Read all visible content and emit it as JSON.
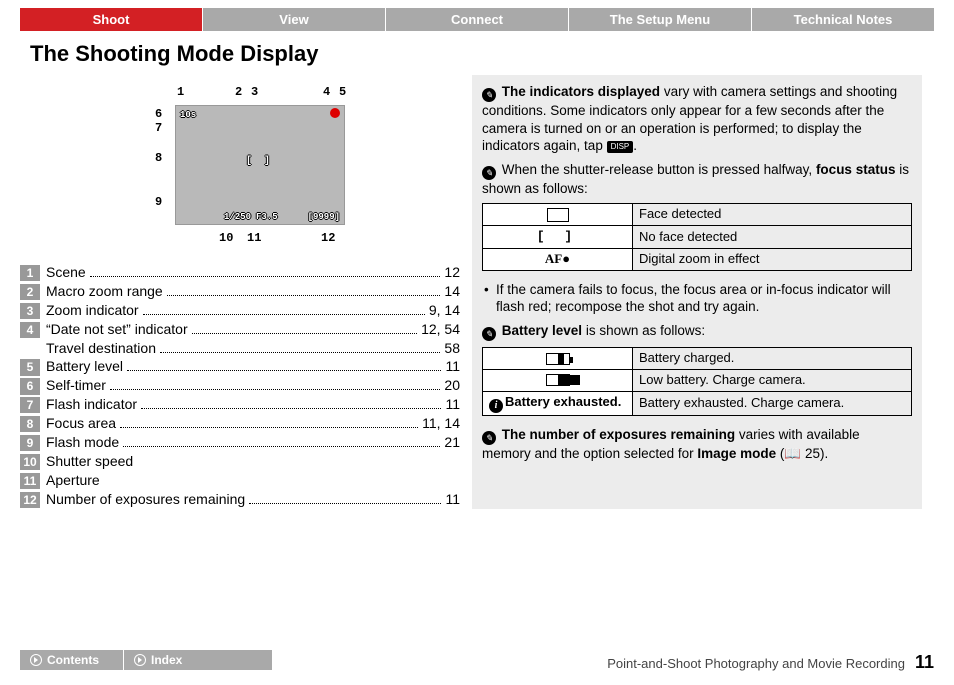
{
  "tabs": [
    "Shoot",
    "View",
    "Connect",
    "The Setup Menu",
    "Technical Notes"
  ],
  "title": "The Shooting Mode Display",
  "callouts": [
    "1",
    "2",
    "3",
    "4",
    "5",
    "6",
    "7",
    "8",
    "9",
    "10",
    "11",
    "12"
  ],
  "screen": {
    "timer": "10s",
    "shutter": "1/250",
    "fnum": "F3.5",
    "remain": "[9999]"
  },
  "list": [
    {
      "n": "1",
      "label": "Scene",
      "page": "12"
    },
    {
      "n": "2",
      "label": "Macro zoom range",
      "page": "14"
    },
    {
      "n": "3",
      "label": "Zoom indicator",
      "page": "9, 14"
    },
    {
      "n": "4",
      "label": "“Date not set” indicator",
      "page": "12, 54"
    },
    {
      "n": "",
      "label": "Travel destination",
      "page": "58"
    },
    {
      "n": "5",
      "label": "Battery level",
      "page": "11"
    },
    {
      "n": "6",
      "label": "Self-timer",
      "page": "20"
    },
    {
      "n": "7",
      "label": "Flash indicator",
      "page": "11"
    },
    {
      "n": "8",
      "label": "Focus area",
      "page": "11, 14"
    },
    {
      "n": "9",
      "label": "Flash mode",
      "page": "21"
    },
    {
      "n": "10",
      "label": "Shutter speed",
      "page": ""
    },
    {
      "n": "11",
      "label": "Aperture",
      "page": ""
    },
    {
      "n": "12",
      "label": "Number of exposures remaining",
      "page": "11"
    }
  ],
  "right": {
    "p1a": "The indicators displayed",
    "p1b": " vary with camera settings and shooting conditions. Some indicators only appear for a few seconds after the camera is turned on or an operation is performed; to display the indicators again, tap ",
    "disp": "DISP",
    "p2a": "When the shutter-release button is pressed halfway, ",
    "p2b": "focus status",
    "p2c": " is shown as follows:",
    "focusTable": [
      {
        "sym": "rect",
        "txt": "Face detected"
      },
      {
        "sym": "brkt",
        "txt": "No face detected"
      },
      {
        "sym": "af",
        "txt": "Digital zoom in effect"
      }
    ],
    "p3": "If the camera fails to focus, the focus area or in-focus indicator will flash red; recompose the shot and try again.",
    "p4a": "Battery level",
    "p4b": " is shown as follows:",
    "battTable": [
      {
        "sym": "batt-low",
        "txt": "Battery charged."
      },
      {
        "sym": "batt-full",
        "txt": "Low battery. Charge camera."
      },
      {
        "sym": "batt-ex",
        "label": "Battery exhausted.",
        "txt": "Battery exhausted. Charge camera."
      }
    ],
    "p5a": "The number of exposures remaining",
    "p5b": " varies with available memory and the option selected for ",
    "p5c": "Image mode",
    "p5d": " 25)."
  },
  "footer": {
    "contents": "Contents",
    "index": "Index",
    "sub": "Point-and-Shoot Photography and Movie Recording",
    "page": "11"
  }
}
